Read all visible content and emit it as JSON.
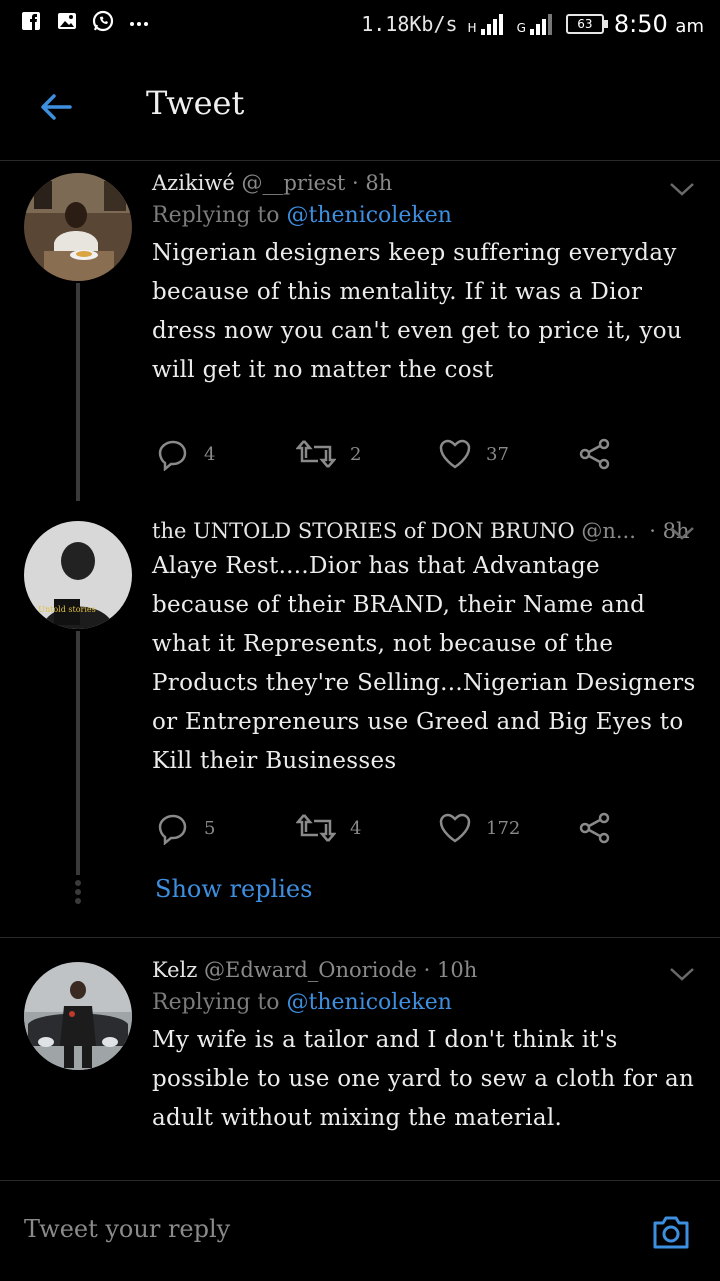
{
  "status_bar": {
    "left_icons": [
      "facebook-icon",
      "gallery-icon",
      "whatsapp-icon",
      "more-notifications-icon"
    ],
    "speed": "1.18Kb/s",
    "sim1_label": "H",
    "sim2_label": "G",
    "battery": "63",
    "time": "8:50",
    "ampm": "am"
  },
  "header": {
    "title": "Tweet"
  },
  "tweets": [
    {
      "name": "Azikiwé",
      "handle": "@__priest",
      "time": "· 8h",
      "replying_prefix": "Replying to ",
      "replying_to": "@thenicoleken",
      "text": "Nigerian designers keep suffering everyday because of this mentality. If it was a Dior dress now you can't even get to price it, you will get it no matter the cost",
      "replies": "4",
      "retweets": "2",
      "likes": "37"
    },
    {
      "name": "the UNTOLD STORIES of DON BRUNO",
      "handle": "@n...",
      "time": "· 8h",
      "text": "Alaye Rest....Dior has that Advantage because of their BRAND, their Name and what it Represents, not because of the Products they're Selling...Nigerian Designers or Entrepreneurs use Greed and Big Eyes to Kill their Businesses",
      "replies": "5",
      "retweets": "4",
      "likes": "172",
      "show_replies": "Show replies",
      "avatar_badge": "Untold stories"
    },
    {
      "name": "Kelz",
      "handle": "@Edward_Onoriode",
      "time": "· 10h",
      "replying_prefix": "Replying to ",
      "replying_to": "@thenicoleken",
      "text": "My wife is a tailor and I don't think it's possible to use one yard to sew a cloth for an adult without mixing the material."
    }
  ],
  "reply_bar": {
    "placeholder": "Tweet your reply"
  },
  "colors": {
    "accent": "#3e8fe0",
    "background": "#000000",
    "muted": "#8a8a8a"
  }
}
